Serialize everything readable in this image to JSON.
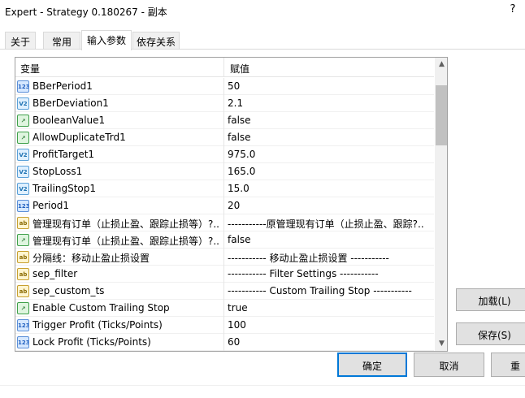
{
  "window": {
    "title": "Expert - Strategy 0.180267 - 副本",
    "help": "?"
  },
  "tabs": [
    {
      "label": "关于",
      "active": false
    },
    {
      "label": "常用",
      "active": false
    },
    {
      "label": "输入参数",
      "active": true
    },
    {
      "label": "依存关系",
      "active": false
    }
  ],
  "grid": {
    "headers": {
      "variable": "变量",
      "value": "赋值"
    },
    "rows": [
      {
        "type": "int",
        "icon": "integer-type-icon",
        "icon_text": "123",
        "name": "BBerPeriod1",
        "value": "50"
      },
      {
        "type": "dbl",
        "icon": "double-type-icon",
        "icon_text": "V2",
        "name": "BBerDeviation1",
        "value": "2.1"
      },
      {
        "type": "bool",
        "icon": "boolean-type-icon",
        "icon_text": "↗",
        "name": "BooleanValue1",
        "value": "false"
      },
      {
        "type": "bool",
        "icon": "boolean-type-icon",
        "icon_text": "↗",
        "name": "AllowDuplicateTrd1",
        "value": "false"
      },
      {
        "type": "dbl",
        "icon": "double-type-icon",
        "icon_text": "V2",
        "name": "ProfitTarget1",
        "value": "975.0"
      },
      {
        "type": "dbl",
        "icon": "double-type-icon",
        "icon_text": "V2",
        "name": "StopLoss1",
        "value": "165.0"
      },
      {
        "type": "dbl",
        "icon": "double-type-icon",
        "icon_text": "V2",
        "name": "TrailingStop1",
        "value": "15.0"
      },
      {
        "type": "int",
        "icon": "integer-type-icon",
        "icon_text": "123",
        "name": "Period1",
        "value": "20"
      },
      {
        "type": "str",
        "icon": "string-type-icon",
        "icon_text": "ab",
        "name": "管理现有订单（止损止盈、跟踪止损等）?..",
        "value": "-----------原管理现有订单（止损止盈、跟踪?.."
      },
      {
        "type": "bool",
        "icon": "boolean-type-icon",
        "icon_text": "↗",
        "name": "管理现有订单（止损止盈、跟踪止损等）?..",
        "value": "false"
      },
      {
        "type": "str",
        "icon": "string-type-icon",
        "icon_text": "ab",
        "name": "分隔线：移动止盈止损设置",
        "value": "----------- 移动止盈止损设置 -----------"
      },
      {
        "type": "str",
        "icon": "string-type-icon",
        "icon_text": "ab",
        "name": "sep_filter",
        "value": "----------- Filter Settings -----------"
      },
      {
        "type": "str",
        "icon": "string-type-icon",
        "icon_text": "ab",
        "name": "sep_custom_ts",
        "value": "----------- Custom Trailing Stop -----------"
      },
      {
        "type": "bool",
        "icon": "boolean-type-icon",
        "icon_text": "↗",
        "name": "Enable Custom Trailing Stop",
        "value": "true"
      },
      {
        "type": "int",
        "icon": "integer-type-icon",
        "icon_text": "123",
        "name": "Trigger Profit (Ticks/Points)",
        "value": "100"
      },
      {
        "type": "int",
        "icon": "integer-type-icon",
        "icon_text": "123",
        "name": "Lock Profit (Ticks/Points)",
        "value": "60"
      }
    ],
    "scroll_up": "▲",
    "scroll_down": "▼"
  },
  "side_buttons": {
    "load": "加载(L)",
    "save": "保存(S)"
  },
  "bottom_buttons": {
    "ok": "确定",
    "cancel": "取消",
    "reset": "重"
  }
}
